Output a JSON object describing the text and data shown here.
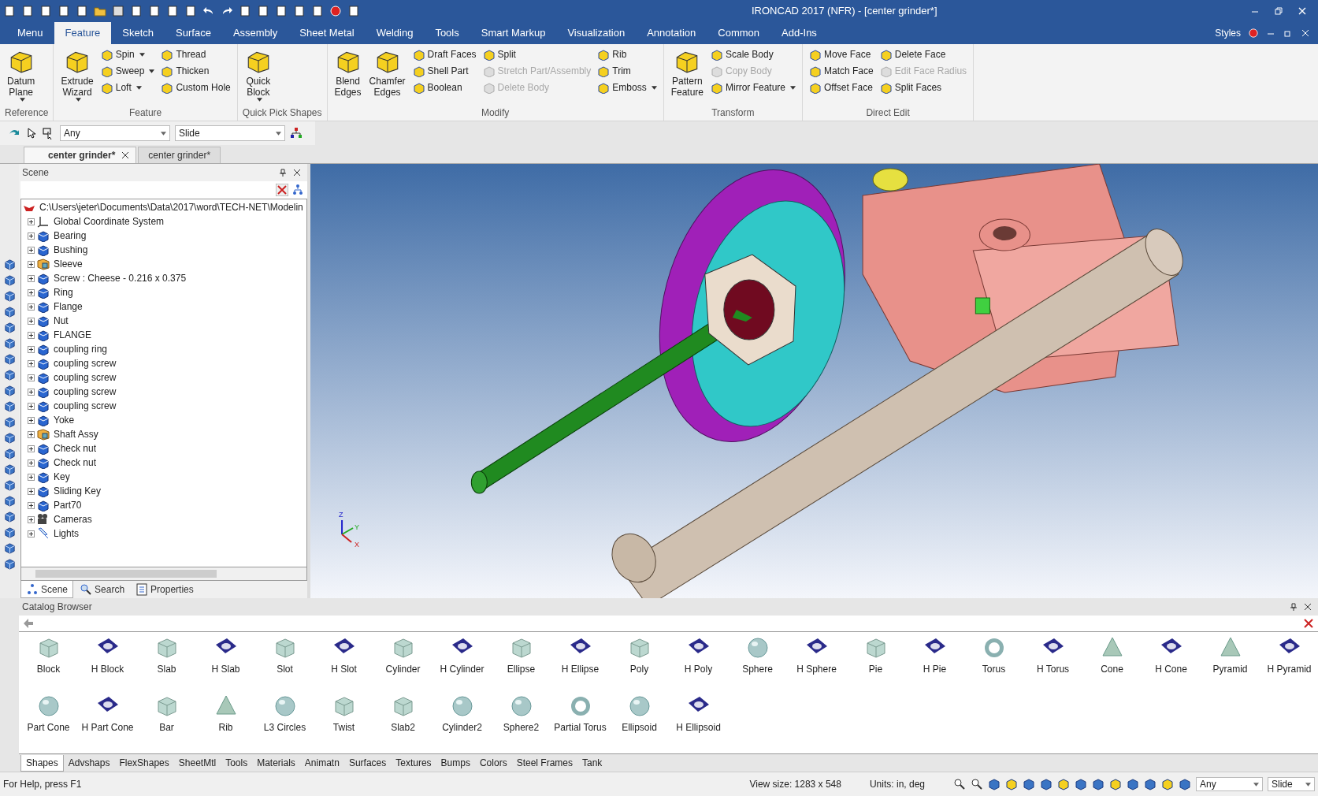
{
  "window": {
    "title": "IRONCAD 2017 (NFR) - [center grinder*]"
  },
  "menu_tabs": [
    {
      "label": "Menu",
      "selected": false
    },
    {
      "label": "Feature",
      "selected": true
    },
    {
      "label": "Sketch",
      "selected": false
    },
    {
      "label": "Surface",
      "selected": false
    },
    {
      "label": "Assembly",
      "selected": false
    },
    {
      "label": "Sheet Metal",
      "selected": false
    },
    {
      "label": "Welding",
      "selected": false
    },
    {
      "label": "Tools",
      "selected": false
    },
    {
      "label": "Smart Markup",
      "selected": false
    },
    {
      "label": "Visualization",
      "selected": false
    },
    {
      "label": "Annotation",
      "selected": false
    },
    {
      "label": "Common",
      "selected": false
    },
    {
      "label": "Add-Ins",
      "selected": false
    }
  ],
  "styles_label": "Styles",
  "ribbon": [
    {
      "title": "Reference",
      "columns": [
        {
          "kind": "large",
          "lines": [
            "Datum",
            "Plane"
          ],
          "dropdown": true
        }
      ]
    },
    {
      "title": "Feature",
      "columns": [
        {
          "kind": "large",
          "lines": [
            "Extrude",
            "Wizard"
          ],
          "dropdown": true
        },
        {
          "kind": "stack",
          "items": [
            {
              "label": "Spin",
              "dropdown": true,
              "disabled": false
            },
            {
              "label": "Sweep",
              "dropdown": true,
              "disabled": false
            },
            {
              "label": "Loft",
              "dropdown": true,
              "disabled": false
            }
          ]
        },
        {
          "kind": "stack",
          "items": [
            {
              "label": "Thread",
              "dropdown": false,
              "disabled": false
            },
            {
              "label": "Thicken",
              "dropdown": false,
              "disabled": false
            },
            {
              "label": "Custom Hole",
              "dropdown": false,
              "disabled": false
            }
          ]
        }
      ]
    },
    {
      "title": "Quick Pick Shapes",
      "columns": [
        {
          "kind": "large",
          "lines": [
            "Quick",
            "Block"
          ],
          "dropdown": true
        }
      ]
    },
    {
      "title": "Modify",
      "columns": [
        {
          "kind": "large",
          "lines": [
            "Blend",
            "Edges"
          ],
          "dropdown": false
        },
        {
          "kind": "large",
          "lines": [
            "Chamfer",
            "Edges"
          ],
          "dropdown": false
        },
        {
          "kind": "stack",
          "items": [
            {
              "label": "Draft Faces",
              "dropdown": false,
              "disabled": false
            },
            {
              "label": "Shell Part",
              "dropdown": false,
              "disabled": false
            },
            {
              "label": "Boolean",
              "dropdown": false,
              "disabled": false
            }
          ]
        },
        {
          "kind": "stack",
          "items": [
            {
              "label": "Split",
              "dropdown": false,
              "disabled": false
            },
            {
              "label": "Stretch Part/Assembly",
              "dropdown": false,
              "disabled": true
            },
            {
              "label": "Delete Body",
              "dropdown": false,
              "disabled": true
            }
          ]
        },
        {
          "kind": "stack",
          "items": [
            {
              "label": "Rib",
              "dropdown": false,
              "disabled": false
            },
            {
              "label": "Trim",
              "dropdown": false,
              "disabled": false
            },
            {
              "label": "Emboss",
              "dropdown": true,
              "disabled": false
            }
          ]
        }
      ]
    },
    {
      "title": "Transform",
      "columns": [
        {
          "kind": "large",
          "lines": [
            "Pattern",
            "Feature"
          ],
          "dropdown": false
        },
        {
          "kind": "stack",
          "items": [
            {
              "label": "Scale Body",
              "dropdown": false,
              "disabled": false
            },
            {
              "label": "Copy Body",
              "dropdown": false,
              "disabled": true
            },
            {
              "label": "Mirror Feature",
              "dropdown": true,
              "disabled": false
            }
          ]
        }
      ]
    },
    {
      "title": "Direct Edit",
      "columns": [
        {
          "kind": "stack",
          "items": [
            {
              "label": "Move Face",
              "dropdown": false,
              "disabled": false
            },
            {
              "label": "Match Face",
              "dropdown": false,
              "disabled": false
            },
            {
              "label": "Offset Face",
              "dropdown": false,
              "disabled": false
            }
          ]
        },
        {
          "kind": "stack",
          "items": [
            {
              "label": "Delete Face",
              "dropdown": false,
              "disabled": false
            },
            {
              "label": "Edit Face Radius",
              "dropdown": false,
              "disabled": true
            },
            {
              "label": "Split Faces",
              "dropdown": false,
              "disabled": false
            }
          ]
        }
      ]
    }
  ],
  "selection_bar": {
    "filter": "Any",
    "mode": "Slide"
  },
  "doc_tabs": [
    {
      "label": "center grinder*",
      "selected": true,
      "closable": true
    },
    {
      "label": "center grinder*",
      "selected": false,
      "closable": false
    }
  ],
  "scene_panel": {
    "title": "Scene",
    "root": "C:\\Users\\jeter\\Documents\\Data\\2017\\word\\TECH-NET\\Modelin",
    "items": [
      {
        "label": "Global Coordinate System",
        "kind": "axes",
        "expanded": false
      },
      {
        "label": "Bearing",
        "kind": "part",
        "expanded": false
      },
      {
        "label": "Bushing",
        "kind": "part",
        "expanded": false
      },
      {
        "label": "Sleeve",
        "kind": "assembly",
        "expanded": false
      },
      {
        "label": "Screw : Cheese - 0.216 x 0.375",
        "kind": "part",
        "expanded": false
      },
      {
        "label": "Ring",
        "kind": "part",
        "expanded": false
      },
      {
        "label": "Flange",
        "kind": "part",
        "expanded": false
      },
      {
        "label": "Nut",
        "kind": "part",
        "expanded": false
      },
      {
        "label": "FLANGE",
        "kind": "part",
        "expanded": false
      },
      {
        "label": "coupling ring",
        "kind": "part",
        "expanded": false
      },
      {
        "label": "coupling screw",
        "kind": "part",
        "expanded": false
      },
      {
        "label": "coupling screw",
        "kind": "part",
        "expanded": false
      },
      {
        "label": "coupling screw",
        "kind": "part",
        "expanded": false
      },
      {
        "label": "coupling screw",
        "kind": "part",
        "expanded": false
      },
      {
        "label": "Yoke",
        "kind": "part",
        "expanded": false
      },
      {
        "label": "Shaft Assy",
        "kind": "assembly",
        "expanded": false
      },
      {
        "label": "Check nut",
        "kind": "part",
        "expanded": false
      },
      {
        "label": "Check nut",
        "kind": "part",
        "expanded": false
      },
      {
        "label": "Key",
        "kind": "part",
        "expanded": false
      },
      {
        "label": "Sliding Key",
        "kind": "part",
        "expanded": false
      },
      {
        "label": "Part70",
        "kind": "part",
        "expanded": false
      },
      {
        "label": "Cameras",
        "kind": "camera",
        "expanded": false
      },
      {
        "label": "Lights",
        "kind": "light",
        "expanded": false
      }
    ],
    "tabs": [
      {
        "label": "Scene",
        "selected": true
      },
      {
        "label": "Search",
        "selected": false
      },
      {
        "label": "Properties",
        "selected": false
      }
    ]
  },
  "viewport": {
    "axis_labels": [
      "Z",
      "Y",
      "X"
    ]
  },
  "catalog": {
    "title": "Catalog Browser",
    "items": [
      {
        "label": "Block",
        "kind": "solid"
      },
      {
        "label": "H Block",
        "kind": "hollow"
      },
      {
        "label": "Slab",
        "kind": "solid"
      },
      {
        "label": "H Slab",
        "kind": "hollow"
      },
      {
        "label": "Slot",
        "kind": "solid"
      },
      {
        "label": "H Slot",
        "kind": "hollow"
      },
      {
        "label": "Cylinder",
        "kind": "solid"
      },
      {
        "label": "H Cylinder",
        "kind": "hollow"
      },
      {
        "label": "Ellipse",
        "kind": "solid"
      },
      {
        "label": "H Ellipse",
        "kind": "hollow"
      },
      {
        "label": "Poly",
        "kind": "solid"
      },
      {
        "label": "H Poly",
        "kind": "hollow"
      },
      {
        "label": "Sphere",
        "kind": "round"
      },
      {
        "label": "H Sphere",
        "kind": "hollow"
      },
      {
        "label": "Pie",
        "kind": "solid"
      },
      {
        "label": "H Pie",
        "kind": "hollow"
      },
      {
        "label": "Torus",
        "kind": "ring"
      },
      {
        "label": "H Torus",
        "kind": "hollow"
      },
      {
        "label": "Cone",
        "kind": "cone"
      },
      {
        "label": "H Cone",
        "kind": "hollow"
      },
      {
        "label": "Pyramid",
        "kind": "cone"
      },
      {
        "label": "H Pyramid",
        "kind": "hollow"
      },
      {
        "label": "Part Cone",
        "kind": "round"
      },
      {
        "label": "H Part Cone",
        "kind": "hollow"
      },
      {
        "label": "Bar",
        "kind": "solid"
      },
      {
        "label": "Rib",
        "kind": "cone"
      },
      {
        "label": "L3 Circles",
        "kind": "round"
      },
      {
        "label": "Twist",
        "kind": "solid"
      },
      {
        "label": "Slab2",
        "kind": "solid"
      },
      {
        "label": "Cylinder2",
        "kind": "round"
      },
      {
        "label": "Sphere2",
        "kind": "round"
      },
      {
        "label": "Partial Torus",
        "kind": "ring"
      },
      {
        "label": "Ellipsoid",
        "kind": "round"
      },
      {
        "label": "H Ellipsoid",
        "kind": "hollow"
      }
    ],
    "tabs": [
      {
        "label": "Shapes",
        "selected": true
      },
      {
        "label": "Advshaps",
        "selected": false
      },
      {
        "label": "FlexShapes",
        "selected": false
      },
      {
        "label": "SheetMtl",
        "selected": false
      },
      {
        "label": "Tools",
        "selected": false
      },
      {
        "label": "Materials",
        "selected": false
      },
      {
        "label": "Animatn",
        "selected": false
      },
      {
        "label": "Surfaces",
        "selected": false
      },
      {
        "label": "Textures",
        "selected": false
      },
      {
        "label": "Bumps",
        "selected": false
      },
      {
        "label": "Colors",
        "selected": false
      },
      {
        "label": "Steel Frames",
        "selected": false
      },
      {
        "label": "Tank",
        "selected": false
      }
    ]
  },
  "status_bar": {
    "help": "For Help, press F1",
    "view_size": "View size: 1283 x  548",
    "units": "Units: in, deg",
    "filter": "Any",
    "mode": "Slide"
  }
}
